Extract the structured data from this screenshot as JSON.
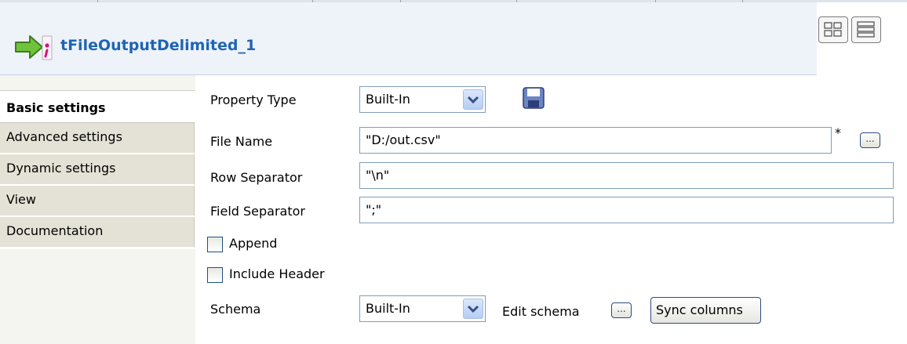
{
  "component": {
    "title": "tFileOutputDelimited_1",
    "icon": "file-output-arrow-icon"
  },
  "layout_buttons": [
    "grid-layout-icon",
    "list-layout-icon"
  ],
  "tabs": [
    {
      "label": "Basic settings",
      "active": true
    },
    {
      "label": "Advanced settings",
      "active": false
    },
    {
      "label": "Dynamic settings",
      "active": false
    },
    {
      "label": "View",
      "active": false
    },
    {
      "label": "Documentation",
      "active": false
    }
  ],
  "form": {
    "property_type": {
      "label": "Property Type",
      "value": "Built-In"
    },
    "file_name": {
      "label": "File Name",
      "value": "\"D:/out.csv\"",
      "required_mark": "*",
      "browse_label": "..."
    },
    "row_separator": {
      "label": "Row Separator",
      "value": "\"\\n\""
    },
    "field_separator": {
      "label": "Field Separator",
      "value": "\";\""
    },
    "append": {
      "label": "Append",
      "checked": false
    },
    "include_header": {
      "label": "Include Header",
      "checked": false
    },
    "schema": {
      "label": "Schema",
      "value": "Built-In",
      "edit_label": "Edit schema",
      "edit_button": "...",
      "sync_label": "Sync columns"
    }
  },
  "colors": {
    "title": "#1e64b4",
    "header_bg": "#eef3fa",
    "tab_bg": "#e4e2d6"
  }
}
